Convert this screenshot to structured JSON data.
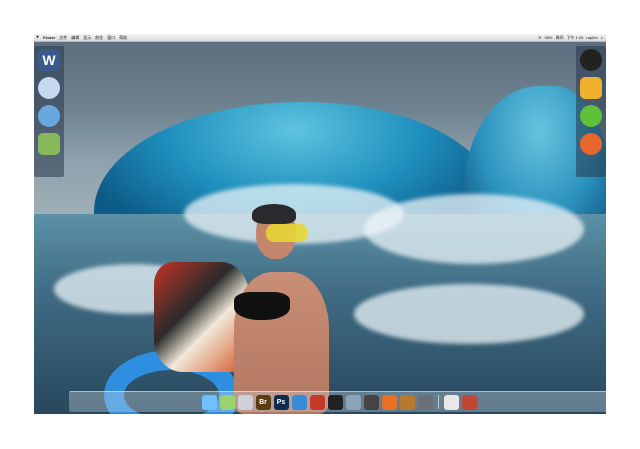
{
  "menubar": {
    "apple_icon": "apple-icon",
    "app_name": "Finder",
    "menus": [
      "文件",
      "编辑",
      "显示",
      "前往",
      "窗口",
      "帮助"
    ],
    "status": {
      "items": [
        "98%",
        "周四",
        "下午 1:03",
        "rapt0n"
      ]
    }
  },
  "left_widgets": [
    "w-launcher-icon",
    "messages-bubble-icon",
    "safari-like-icon",
    "users-icon"
  ],
  "left_widget_letter": "W",
  "right_widgets": [
    "qq-penguin-icon",
    "pencil-icon",
    "wechat-icon",
    "firefox-icon"
  ],
  "dock": {
    "items": [
      {
        "name": "finder-icon",
        "label": "",
        "color": "#6ec1ff"
      },
      {
        "name": "messages-icon",
        "label": "",
        "color": "#9bd16e"
      },
      {
        "name": "itunes-icon",
        "label": "",
        "color": "#d0d0d8"
      },
      {
        "name": "bridge-icon",
        "label": "Br",
        "color": "#5b3d13"
      },
      {
        "name": "photoshop-icon",
        "label": "Ps",
        "color": "#0f2a4d"
      },
      {
        "name": "safari-icon",
        "label": "",
        "color": "#3a8ad8"
      },
      {
        "name": "mission-control-icon",
        "label": "",
        "color": "#c53a2a"
      },
      {
        "name": "qq-icon",
        "label": "",
        "color": "#222"
      },
      {
        "name": "preview-icon",
        "label": "",
        "color": "#8ca4b8"
      },
      {
        "name": "final-cut-icon",
        "label": "",
        "color": "#444"
      },
      {
        "name": "photos-icon",
        "label": "",
        "color": "#e86f25"
      },
      {
        "name": "calculator-icon",
        "label": "",
        "color": "#b67a2e"
      },
      {
        "name": "system-preferences-icon",
        "label": "",
        "color": "#6b6f78"
      },
      {
        "name": "document-icon",
        "label": "",
        "color": "#e8e8ea"
      },
      {
        "name": "slides-icon",
        "label": "",
        "color": "#c14735"
      }
    ]
  }
}
